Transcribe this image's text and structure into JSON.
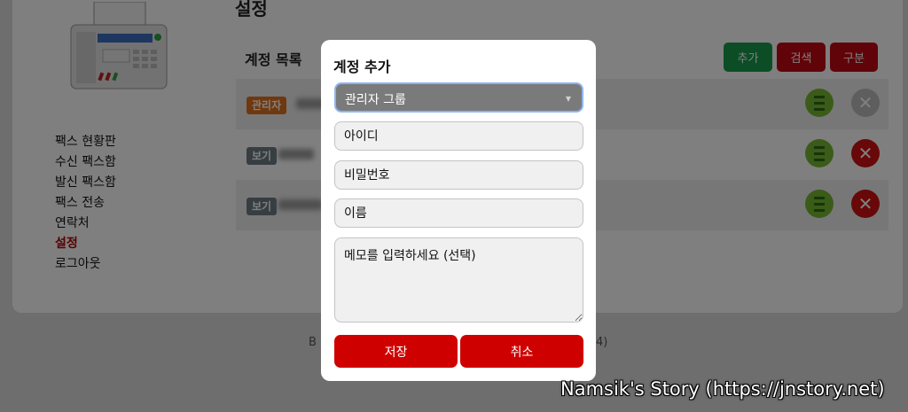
{
  "sidebar": {
    "items": [
      "팩스 현황판",
      "수신 팩스함",
      "발신 팩스함",
      "팩스 전송",
      "연락처",
      "설정",
      "로그아웃"
    ],
    "active_index": 5
  },
  "header": {
    "title": "설정"
  },
  "accounts": {
    "title": "계정 목록",
    "buttons": {
      "add": "추가",
      "search": "검색",
      "group": "구분"
    },
    "rows": [
      {
        "badge": "관리자",
        "badge_type": "admin",
        "delete_enabled": false
      },
      {
        "badge": "보기",
        "badge_type": "view",
        "delete_enabled": true
      },
      {
        "badge": "보기",
        "badge_type": "view",
        "delete_enabled": true
      }
    ]
  },
  "footer": {
    "left_fragment": "B",
    "right_fragment": "4)"
  },
  "modal": {
    "title": "계정 추가",
    "group_select": {
      "value": "관리자 그룹"
    },
    "id_placeholder": "아이디",
    "password_placeholder": "비밀번호",
    "name_placeholder": "이름",
    "memo_placeholder": "메모를 입력하세요 (선택)",
    "save_label": "저장",
    "cancel_label": "취소"
  },
  "watermark": "Namsik's Story (https://jnstory.net)",
  "colors": {
    "primary_red": "#cf0000",
    "green": "#189a4c",
    "admin_orange": "#e0701c",
    "view_gray": "#6f7d84"
  }
}
